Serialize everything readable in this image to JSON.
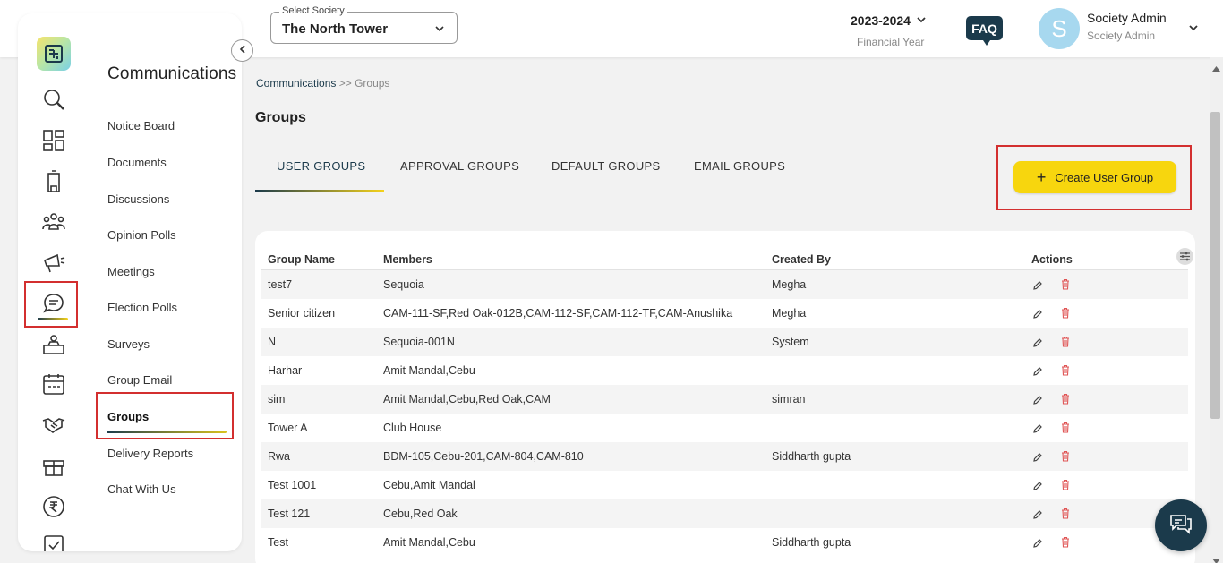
{
  "header": {
    "select_society_label": "Select Society",
    "select_society_value": "The North Tower",
    "financial_year": "2023-2024",
    "financial_year_label": "Financial Year",
    "faq": "FAQ",
    "avatar_initial": "S",
    "user_name": "Society Admin",
    "user_role": "Society Admin"
  },
  "sidebar": {
    "rail_icons": [
      "search-icon",
      "dashboard-icon",
      "building-icon",
      "people-icon",
      "megaphone-icon",
      "chat-icon",
      "desk-icon",
      "calendar-icon",
      "handshake-icon",
      "gift-icon",
      "rupee-icon"
    ],
    "title": "Communications",
    "items": [
      {
        "label": "Notice Board"
      },
      {
        "label": "Documents"
      },
      {
        "label": "Discussions"
      },
      {
        "label": "Opinion Polls"
      },
      {
        "label": "Meetings"
      },
      {
        "label": "Election Polls"
      },
      {
        "label": "Surveys"
      },
      {
        "label": "Group Email"
      },
      {
        "label": "Groups"
      },
      {
        "label": "Delivery Reports"
      },
      {
        "label": "Chat With Us"
      }
    ],
    "active_item": "Groups"
  },
  "breadcrumb": {
    "parent": "Communications",
    "sep": ">>",
    "current": "Groups"
  },
  "page_title": "Groups",
  "tabs": [
    {
      "label": "USER GROUPS"
    },
    {
      "label": "APPROVAL GROUPS"
    },
    {
      "label": "DEFAULT GROUPS"
    },
    {
      "label": "EMAIL GROUPS"
    }
  ],
  "active_tab": "USER GROUPS",
  "create_button": {
    "label": "Create User Group",
    "color": "#f7d60e"
  },
  "table": {
    "headers": {
      "name": "Group Name",
      "members": "Members",
      "created_by": "Created By",
      "actions": "Actions"
    },
    "rows": [
      {
        "name": "test7",
        "members": "Sequoia",
        "created_by": "Megha"
      },
      {
        "name": "Senior citizen",
        "members": "CAM-111-SF,Red Oak-012B,CAM-112-SF,CAM-112-TF,CAM-Anushika",
        "created_by": "Megha"
      },
      {
        "name": "N",
        "members": "Sequoia-001N",
        "created_by": "System"
      },
      {
        "name": "Harhar",
        "members": "Amit Mandal,Cebu",
        "created_by": ""
      },
      {
        "name": "sim",
        "members": "Amit Mandal,Cebu,Red Oak,CAM",
        "created_by": "simran"
      },
      {
        "name": "Tower A",
        "members": "Club House",
        "created_by": ""
      },
      {
        "name": "Rwa",
        "members": "BDM-105,Cebu-201,CAM-804,CAM-810",
        "created_by": "Siddharth gupta"
      },
      {
        "name": "Test 1001",
        "members": "Cebu,Amit Mandal",
        "created_by": ""
      },
      {
        "name": "Test 121",
        "members": "Cebu,Red Oak",
        "created_by": ""
      },
      {
        "name": "Test",
        "members": "Amit Mandal,Cebu",
        "created_by": "Siddharth gupta"
      }
    ]
  },
  "colors": {
    "brand_dark": "#1b3a4b",
    "accent_yellow": "#f7d60e",
    "highlight_red": "#d32f2f",
    "delete_red": "#e05555"
  }
}
